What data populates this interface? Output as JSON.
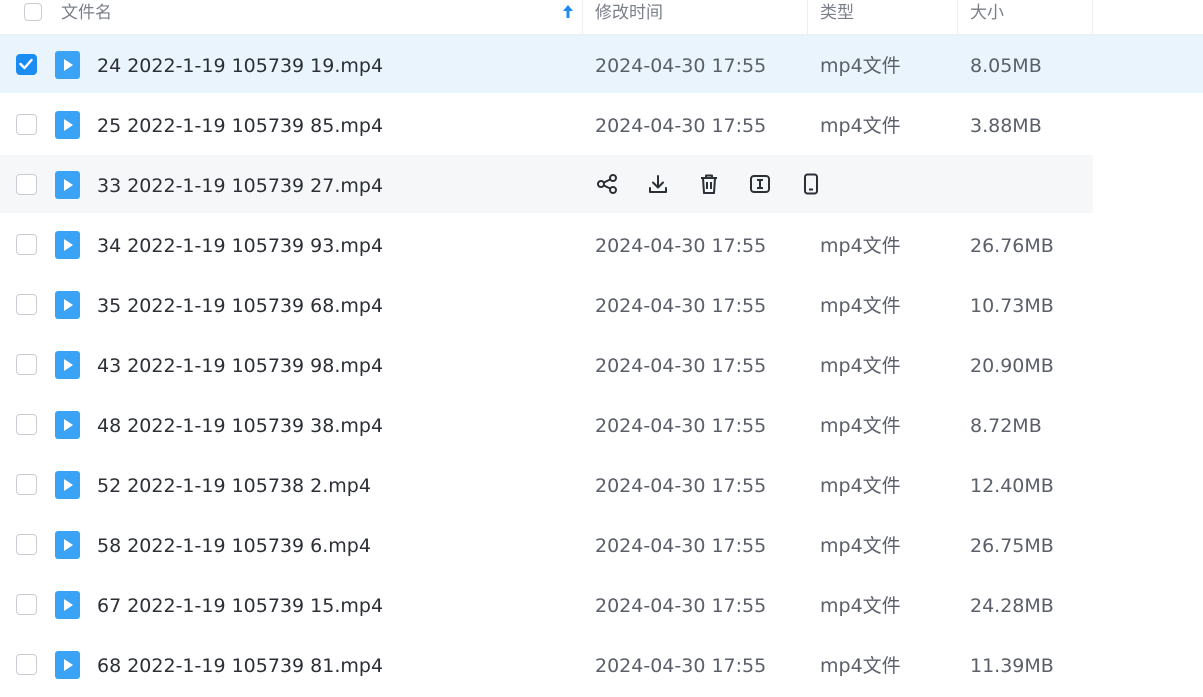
{
  "header": {
    "name_label": "文件名",
    "mtime_label": "修改时间",
    "type_label": "类型",
    "size_label": "大小"
  },
  "colors": {
    "accent": "#1a8cf2",
    "selected_row_bg": "#eaf4fd",
    "hover_row_bg": "#f6f7f9",
    "video_icon": "#3aa3f5"
  },
  "rows": [
    {
      "name": "24 2022-1-19 105739 19.mp4",
      "mtime": "2024-04-30 17:55",
      "type": "mp4文件",
      "size": "8.05MB",
      "state": "selected"
    },
    {
      "name": "25 2022-1-19 105739 85.mp4",
      "mtime": "2024-04-30 17:55",
      "type": "mp4文件",
      "size": "3.88MB",
      "state": "normal"
    },
    {
      "name": "33 2022-1-19 105739 27.mp4",
      "mtime": "",
      "type": "",
      "size": "",
      "state": "hover"
    },
    {
      "name": "34 2022-1-19 105739 93.mp4",
      "mtime": "2024-04-30 17:55",
      "type": "mp4文件",
      "size": "26.76MB",
      "state": "normal"
    },
    {
      "name": "35 2022-1-19 105739 68.mp4",
      "mtime": "2024-04-30 17:55",
      "type": "mp4文件",
      "size": "10.73MB",
      "state": "normal"
    },
    {
      "name": "43 2022-1-19 105739 98.mp4",
      "mtime": "2024-04-30 17:55",
      "type": "mp4文件",
      "size": "20.90MB",
      "state": "normal"
    },
    {
      "name": "48 2022-1-19 105739 38.mp4",
      "mtime": "2024-04-30 17:55",
      "type": "mp4文件",
      "size": "8.72MB",
      "state": "normal"
    },
    {
      "name": "52 2022-1-19 105738 2.mp4",
      "mtime": "2024-04-30 17:55",
      "type": "mp4文件",
      "size": "12.40MB",
      "state": "normal"
    },
    {
      "name": "58 2022-1-19 105739 6.mp4",
      "mtime": "2024-04-30 17:55",
      "type": "mp4文件",
      "size": "26.75MB",
      "state": "normal"
    },
    {
      "name": "67 2022-1-19 105739 15.mp4",
      "mtime": "2024-04-30 17:55",
      "type": "mp4文件",
      "size": "24.28MB",
      "state": "normal"
    },
    {
      "name": "68 2022-1-19 105739 81.mp4",
      "mtime": "2024-04-30 17:55",
      "type": "mp4文件",
      "size": "11.39MB",
      "state": "normal"
    }
  ],
  "hover_actions": [
    "share-icon",
    "download-icon",
    "delete-icon",
    "rename-icon",
    "phone-icon"
  ]
}
